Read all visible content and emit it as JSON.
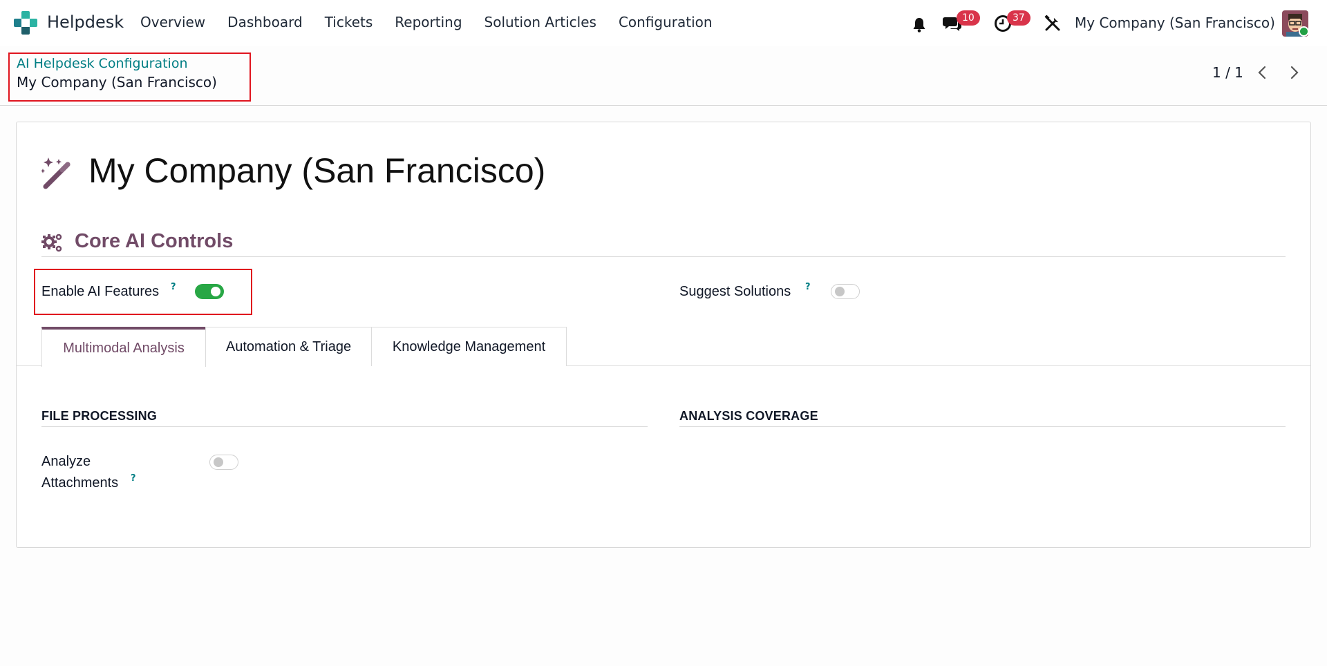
{
  "navbar": {
    "app_name": "Helpdesk",
    "menu": [
      "Overview",
      "Dashboard",
      "Tickets",
      "Reporting",
      "Solution Articles",
      "Configuration"
    ],
    "messages_count": "10",
    "activities_count": "37",
    "company": "My Company (San Francisco)"
  },
  "control_panel": {
    "breadcrumb_parent": "AI Helpdesk Configuration",
    "breadcrumb_current": "My Company (San Francisco)",
    "pager": "1 / 1"
  },
  "form": {
    "title": "My Company (San Francisco)",
    "section_title": "Core AI Controls",
    "enable_ai_label": "Enable AI Features",
    "enable_ai_value": true,
    "suggest_solutions_label": "Suggest Solutions",
    "suggest_solutions_value": false,
    "help_mark": "?",
    "tabs": [
      "Multimodal Analysis",
      "Automation & Triage",
      "Knowledge Management"
    ],
    "active_tab": "Multimodal Analysis",
    "group_file_processing": "FILE PROCESSING",
    "group_analysis_coverage": "ANALYSIS COVERAGE",
    "analyze_label_line1": "Analyze",
    "analyze_label_line2": "Attachments",
    "analyze_attachments_value": false
  },
  "colors": {
    "brand": "#714b67",
    "link": "#017e84",
    "toggle_on": "#28a745",
    "badge": "#d9344a",
    "highlight": "#e0141e"
  }
}
